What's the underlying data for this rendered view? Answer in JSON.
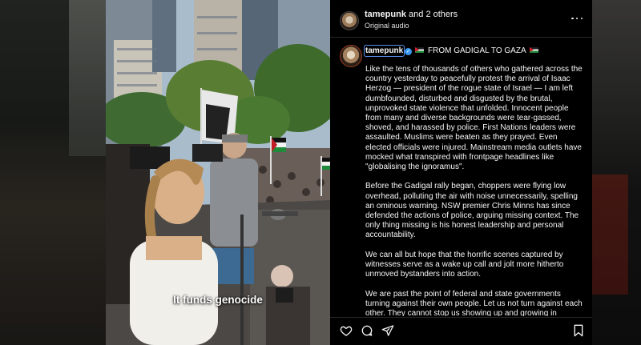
{
  "video": {
    "caption": "It funds genocide"
  },
  "post": {
    "header": {
      "username": "tamepunk",
      "collab_suffix": "and 2 others",
      "audio": "Original audio"
    },
    "author": {
      "username": "tamepunk",
      "title_after": "FROM GADIGAL TO GAZA"
    },
    "caption_paragraphs": [
      "Like the tens of thousands of others who gathered across the country yesterday to peacefully protest the arrival of Isaac Herzog — president of the rogue state of Israel — I am left dumbfounded, disturbed and disgusted by the brutal, unprovoked state violence that unfolded. Innocent people from many and diverse backgrounds were tear-gassed, shoved, and harassed by police. First Nations leaders were assaulted. Muslims were beaten as they prayed. Even elected officials were injured. Mainstream media outlets have mocked what transpired with frontpage headlines like \"globalising the ignoramus\".",
      "Before the Gadigal rally began, choppers were flying low overhead, polluting the air with noise unnecessarily, spelling an ominous warning. NSW premier Chris Minns has since defended the actions of police, arguing missing context. The only thing missing is his honest leadership and personal accountability.",
      "We can all but hope that the horrific scenes captured by witnesses serve as a wake up call and jolt more hitherto unmoved bystanders into action.",
      "We are past the point of federal and state governments turning against their own people. Let us not turn against each other. They cannot stop us showing up and growing in numbers, no matter how hard they try. They can silence a"
    ]
  },
  "icons": {
    "more": "more-horizontal-icon",
    "like": "heart-icon",
    "comment": "comment-icon",
    "share": "send-icon",
    "save": "bookmark-icon",
    "verified": "verified-badge-icon",
    "flag": "palestine-flag-icon"
  },
  "colors": {
    "panel_bg": "#000000",
    "text": "#f5f5f5",
    "verified": "#3897f0",
    "focus_outline": "#5b8def"
  }
}
